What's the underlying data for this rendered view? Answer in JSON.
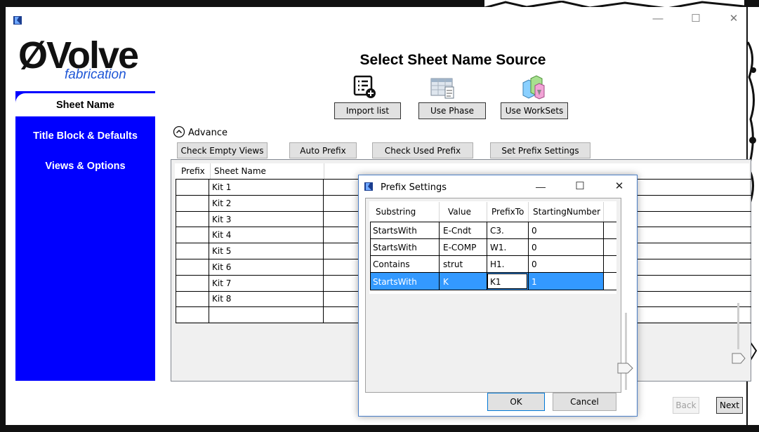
{
  "window": {
    "minimize_glyph": "—",
    "maximize_glyph": "☐",
    "close_glyph": "✕"
  },
  "logo": {
    "brand": "ØVolve",
    "sub": "fabrication"
  },
  "header": {
    "title": "Select Sheet Name Source"
  },
  "source_buttons": {
    "import_label": "Import list",
    "phase_label": "Use Phase",
    "worksets_label": "Use WorkSets"
  },
  "sidebar": {
    "items": [
      {
        "label": "Sheet Name"
      },
      {
        "label": "Title Block & Defaults"
      },
      {
        "label": "Views & Options"
      }
    ]
  },
  "advance": {
    "label": "Advance",
    "chevron": "⌃"
  },
  "toolbar": {
    "check_empty": "Check Empty Views",
    "auto_prefix": "Auto Prefix",
    "check_used": "Check Used Prefix",
    "set_prefix": "Set Prefix Settings"
  },
  "sheet_table": {
    "columns": [
      "Prefix",
      "Sheet Name"
    ],
    "rows": [
      "Kit 1",
      "Kit 2",
      "Kit 3",
      "Kit 4",
      "Kit 5",
      "Kit 6",
      "Kit 7",
      "Kit 8"
    ]
  },
  "dialog": {
    "title": "Prefix Settings",
    "columns": [
      "Substring",
      "Value",
      "PrefixTo",
      "StartingNumber"
    ],
    "rows": [
      {
        "substring": "StartsWith",
        "value": "E-Cndt",
        "prefix": "C3.",
        "start": "0"
      },
      {
        "substring": "StartsWith",
        "value": "E-COMP",
        "prefix": "W1.",
        "start": "0"
      },
      {
        "substring": "Contains",
        "value": "strut",
        "prefix": "H1.",
        "start": "0"
      },
      {
        "substring": "StartsWith",
        "value": "K",
        "prefix": "K1",
        "start": "1"
      }
    ],
    "ok_label": "OK",
    "cancel_label": "Cancel",
    "selection_color": "#3399ff"
  },
  "nav": {
    "back_label": "Back",
    "next_label": "Next"
  },
  "colors": {
    "sidebar": "#0000ff",
    "accent": "#3399ff"
  }
}
